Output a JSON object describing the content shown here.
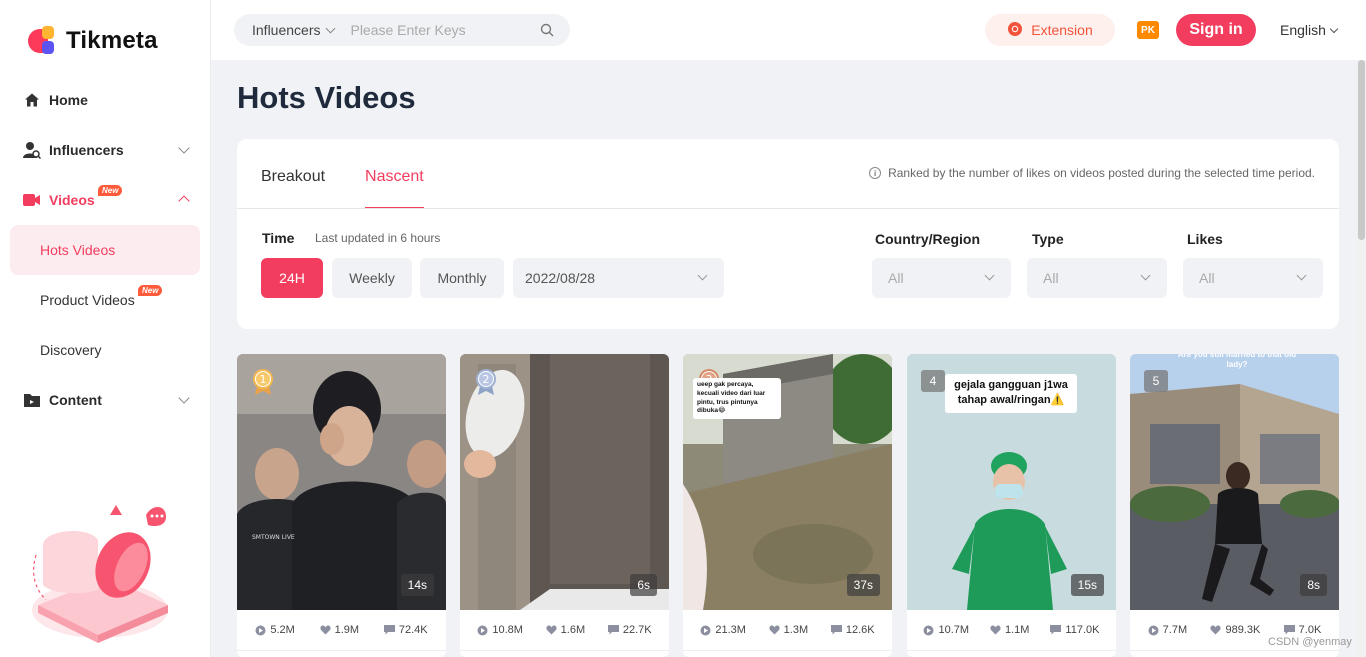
{
  "brand": {
    "name": "Tikmeta"
  },
  "sidebar": {
    "items": [
      {
        "label": "Home",
        "icon": "home-icon"
      },
      {
        "label": "Influencers",
        "icon": "influencer-icon"
      },
      {
        "label": "Videos",
        "icon": "video-icon",
        "badge": "New"
      },
      {
        "label": "Content",
        "icon": "folder-icon"
      }
    ],
    "sub_items": [
      {
        "label": "Hots Videos"
      },
      {
        "label": "Product Videos",
        "badge": "New"
      },
      {
        "label": "Discovery"
      }
    ]
  },
  "topbar": {
    "search_scope": "Influencers",
    "search_placeholder": "Please Enter Keys",
    "extension_label": "Extension",
    "pk_label": "PK",
    "signin_label": "Sign in",
    "language": "English"
  },
  "page": {
    "title": "Hots Videos"
  },
  "filters": {
    "tabs": [
      "Breakout",
      "Nascent"
    ],
    "active_tab": "Nascent",
    "hint": "Ranked by the number of likes on videos posted during the selected time period.",
    "time_label": "Time",
    "time_note": "Last updated in 6 hours",
    "time_options": [
      "24H",
      "Weekly",
      "Monthly"
    ],
    "date": "2022/08/28",
    "country_label": "Country/Region",
    "country_value": "All",
    "type_label": "Type",
    "type_value": "All",
    "likes_label": "Likes",
    "likes_value": "All"
  },
  "videos": [
    {
      "rank": "1",
      "duration": "14s",
      "views": "5.2M",
      "likes": "1.9M",
      "comments": "72.4K",
      "overlay": ""
    },
    {
      "rank": "2",
      "duration": "6s",
      "views": "10.8M",
      "likes": "1.6M",
      "comments": "22.7K",
      "overlay": ""
    },
    {
      "rank": "3",
      "duration": "37s",
      "views": "21.3M",
      "likes": "1.3M",
      "comments": "12.6K",
      "overlay": "ueep gak percaya, kecuali video dari luar pintu, trus pintunya dibuka😂"
    },
    {
      "rank": "4",
      "duration": "15s",
      "views": "10.7M",
      "likes": "1.1M",
      "comments": "117.0K",
      "overlay": "gejala gangguan j1wa tahap awal/ringan⚠️"
    },
    {
      "rank": "5",
      "duration": "8s",
      "views": "7.7M",
      "likes": "989.3K",
      "comments": "7.0K",
      "overlay": "Are you still married to that old lady?"
    }
  ],
  "watermark": "CSDN @yenmay",
  "colors": {
    "accent": "#f23d5e",
    "extension": "#f2533b"
  }
}
